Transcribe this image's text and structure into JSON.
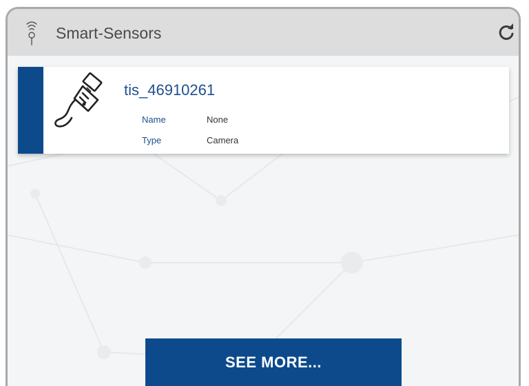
{
  "widget": {
    "title": "Smart-Sensors",
    "title_icon": "sensor-icon",
    "refresh_icon": "refresh-icon"
  },
  "sensors": [
    {
      "title": "tis_46910261",
      "icon": "usb-icon",
      "properties": [
        {
          "key": "Name",
          "value": "None"
        },
        {
          "key": "Type",
          "value": "Camera"
        }
      ]
    }
  ],
  "actions": {
    "see_more_label": "SEE MORE..."
  },
  "colors": {
    "accent": "#0d4a8c",
    "link_text": "#1e4f8c",
    "header_bg": "#dddddd",
    "panel_bg": "#f4f5f6",
    "border": "#a9a9a9"
  }
}
